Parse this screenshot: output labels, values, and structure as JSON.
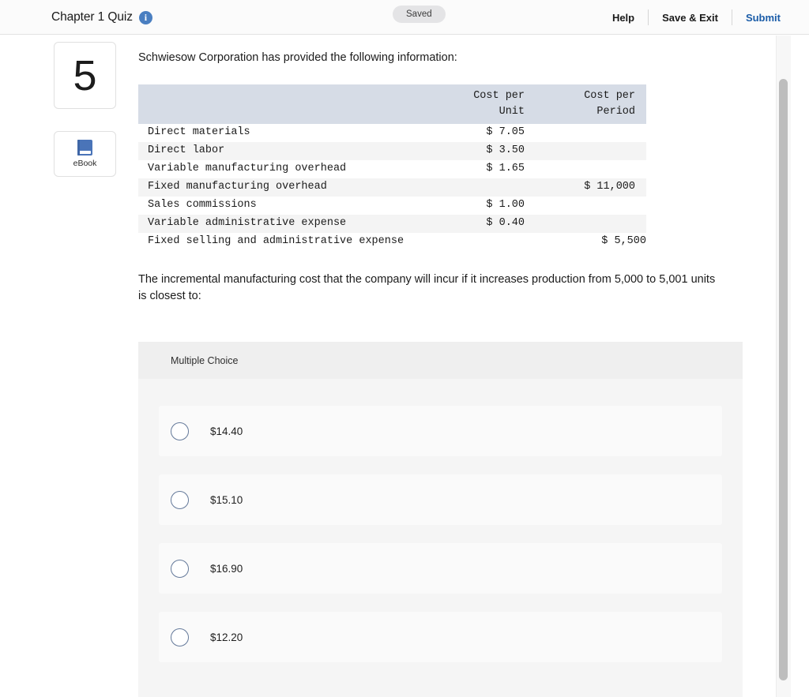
{
  "header": {
    "title": "Chapter 1 Quiz",
    "info_icon": "info-icon",
    "status_badge": "Saved",
    "help_label": "Help",
    "save_exit_label": "Save & Exit",
    "submit_label": "Submit",
    "submit_color": "#1a5ca8"
  },
  "rail": {
    "question_number": "5",
    "ebook_label": "eBook",
    "ebook_icon": "book-icon",
    "ebook_color": "#4a74b8"
  },
  "content": {
    "stem": "Schwiesow Corporation has provided the following information:",
    "question": "The incremental manufacturing cost that the company will incur if it increases production from 5,000 to 5,001 units is closest to:"
  },
  "table": {
    "headers": [
      "",
      "Cost per Unit",
      "Cost per Period"
    ],
    "header_line1": [
      "Cost per",
      "Cost per"
    ],
    "header_line2": [
      "Unit",
      "Period"
    ],
    "header_bg": "#d6dce6",
    "rows": [
      {
        "label": "Direct materials",
        "cost_per_unit": "$ 7.05",
        "cost_per_period": ""
      },
      {
        "label": "Direct labor",
        "cost_per_unit": "$ 3.50",
        "cost_per_period": ""
      },
      {
        "label": "Variable manufacturing overhead",
        "cost_per_unit": "$ 1.65",
        "cost_per_period": ""
      },
      {
        "label": "Fixed manufacturing overhead",
        "cost_per_unit": "",
        "cost_per_period": "$ 11,000"
      },
      {
        "label": "Sales commissions",
        "cost_per_unit": "$ 1.00",
        "cost_per_period": ""
      },
      {
        "label": "Variable administrative expense",
        "cost_per_unit": "$ 0.40",
        "cost_per_period": ""
      },
      {
        "label": "Fixed selling and administrative expense",
        "cost_per_unit": "",
        "cost_per_period": "$ 5,500"
      }
    ]
  },
  "answer_panel": {
    "type_label": "Multiple Choice",
    "options": [
      {
        "label": "$14.40",
        "selected": false
      },
      {
        "label": "$15.10",
        "selected": false
      },
      {
        "label": "$16.90",
        "selected": false
      },
      {
        "label": "$12.20",
        "selected": false
      }
    ]
  },
  "scrollbar": {
    "thumb_color": "#bdbdbd"
  }
}
